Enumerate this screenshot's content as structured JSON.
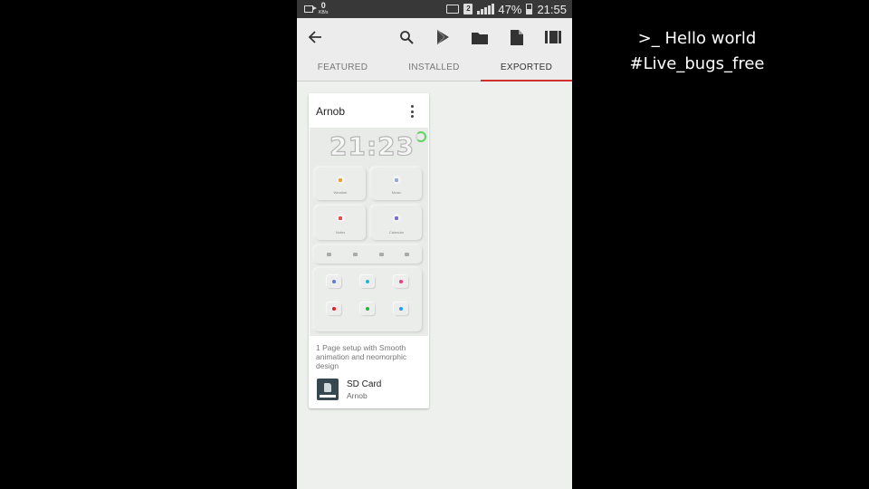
{
  "overlay": {
    "line1": ">_ Hello world",
    "line2": "#Live_bugs_free"
  },
  "statusbar": {
    "speed_value": "0",
    "speed_unit": "KB/s",
    "sim_label": "2",
    "battery_percent": "47%",
    "time": "21:55"
  },
  "appbar": {
    "icons": [
      "back-arrow-icon",
      "search-icon",
      "play-store-icon",
      "folder-icon",
      "file-icon",
      "barcode-icon"
    ]
  },
  "tabs": [
    {
      "label": "FEATURED",
      "active": false
    },
    {
      "label": "INSTALLED",
      "active": false
    },
    {
      "label": "EXPORTED",
      "active": true
    }
  ],
  "card": {
    "title": "Arnob",
    "preview": {
      "clock": "21:23",
      "tiles": [
        "Weather",
        "Music",
        "Notes",
        "Calendar"
      ]
    },
    "description": "1 Page setup with Smooth animation and neomorphic design",
    "source_name": "SD Card",
    "author": "Arnob"
  },
  "colors": {
    "accent": "#d32f2f",
    "statusbar": "#383838",
    "background": "#edf0ed"
  }
}
